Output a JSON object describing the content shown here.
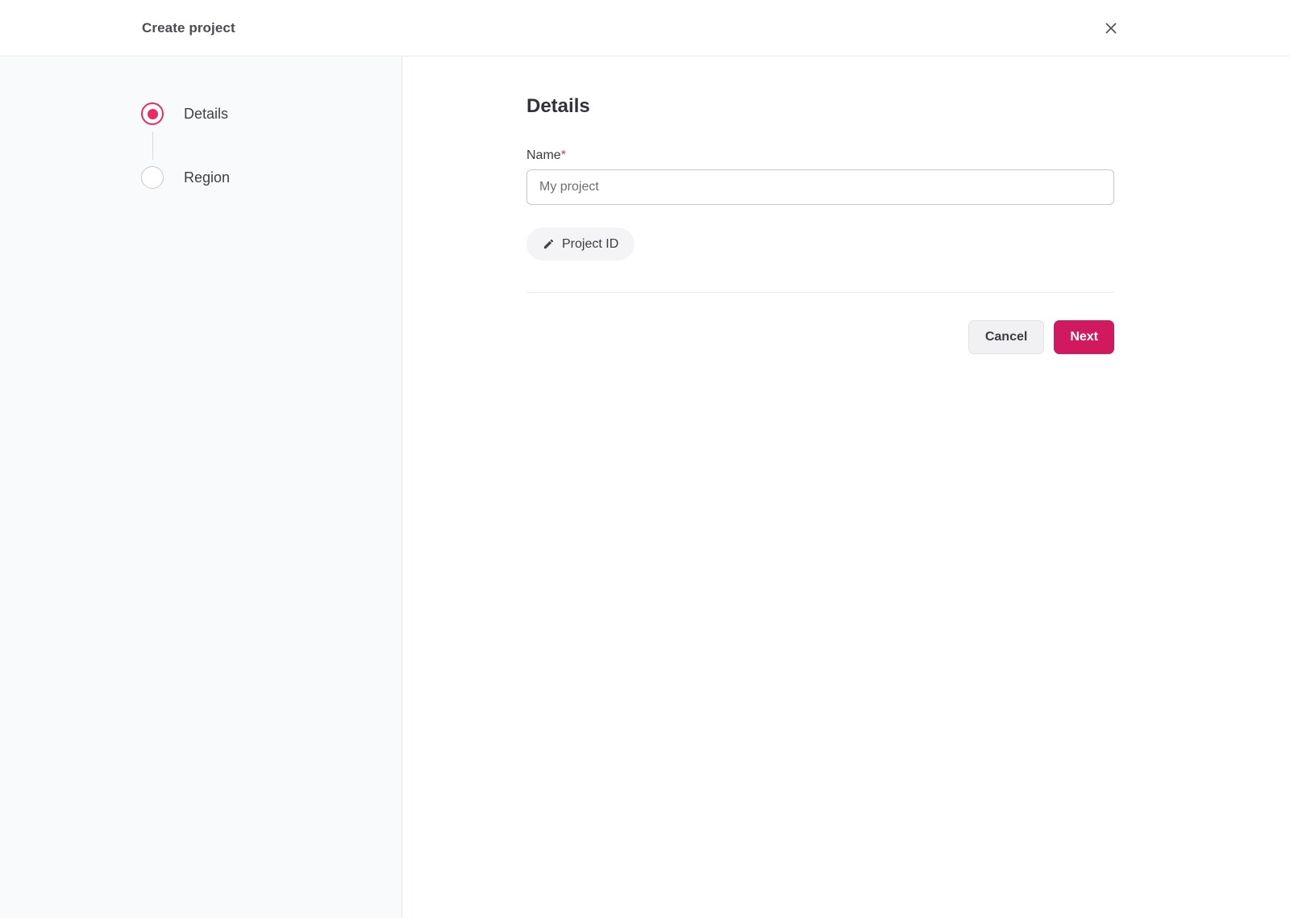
{
  "header": {
    "title": "Create project",
    "close_icon": "close-icon"
  },
  "colors": {
    "accent": "#d11a5e",
    "radio_accent": "#ec2b63",
    "sidebar_bg": "#f9fafb",
    "required_red": "#e5354b"
  },
  "stepper": {
    "steps": [
      {
        "label": "Details",
        "state": "active"
      },
      {
        "label": "Region",
        "state": "inactive"
      }
    ]
  },
  "main": {
    "heading": "Details",
    "form": {
      "name_label": "Name",
      "required_marker": "*",
      "name_placeholder": "My project",
      "name_value": "",
      "project_id_button": "Project ID",
      "project_id_icon": "edit-pencil-icon"
    },
    "footer": {
      "cancel_label": "Cancel",
      "next_label": "Next"
    }
  }
}
